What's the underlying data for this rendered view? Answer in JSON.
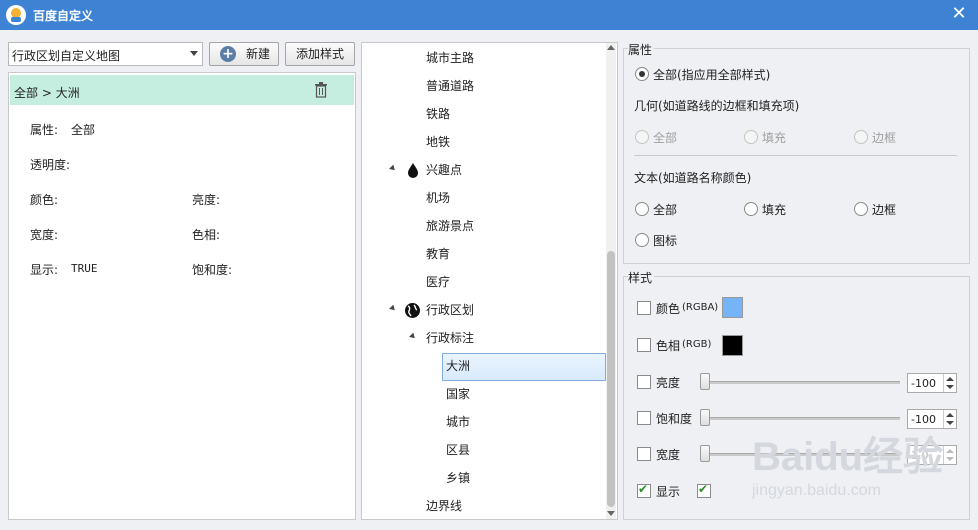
{
  "window": {
    "title": "百度自定义"
  },
  "left": {
    "map_select": "行政区划自定义地图",
    "new_button": "新建",
    "add_style_button": "添加样式",
    "breadcrumb": "全部 > 大洲",
    "props": {
      "attr_label": "属性:",
      "attr_value": "全部",
      "opacity_label": "透明度:",
      "color_label": "颜色:",
      "brightness_label": "亮度:",
      "width_label": "宽度:",
      "hue_label": "色相:",
      "display_label": "显示:",
      "display_value": "TRUE",
      "saturation_label": "饱和度:"
    }
  },
  "tree": {
    "items": [
      {
        "label": "城市主路"
      },
      {
        "label": "普通道路"
      },
      {
        "label": "铁路"
      },
      {
        "label": "地铁"
      },
      {
        "label": "兴趣点",
        "icon": "drop-icon"
      },
      {
        "label": "机场"
      },
      {
        "label": "旅游景点"
      },
      {
        "label": "教育"
      },
      {
        "label": "医疗"
      },
      {
        "label": "行政区划",
        "icon": "globe-icon"
      },
      {
        "label": "行政标注"
      },
      {
        "label": "大洲",
        "selected": true
      },
      {
        "label": "国家"
      },
      {
        "label": "城市"
      },
      {
        "label": "区县"
      },
      {
        "label": "乡镇"
      },
      {
        "label": "边界线"
      }
    ]
  },
  "attributes": {
    "title": "属性",
    "all_option": "全部(指应用全部样式)",
    "geometry_label": "几何(如道路线的边框和填充项)",
    "geometry_options": [
      "全部",
      "填充",
      "边框"
    ],
    "text_label": "文本(如道路名称颜色)",
    "text_options": [
      "全部",
      "填充",
      "边框",
      "图标"
    ]
  },
  "style": {
    "title": "样式",
    "color_label": "颜色",
    "color_mode": "(RGBA)",
    "color_value": "#74b4f7",
    "hue_label": "色相",
    "hue_mode": "(RGB)",
    "hue_value": "#000000",
    "brightness_label": "亮度",
    "brightness_value": "-100",
    "saturation_label": "饱和度",
    "saturation_value": "-100",
    "width_label": "宽度",
    "width_value": "1.0",
    "display_label": "显示"
  },
  "watermark": {
    "text": "Baidu经验",
    "sub": "jingyan.baidu.com"
  }
}
